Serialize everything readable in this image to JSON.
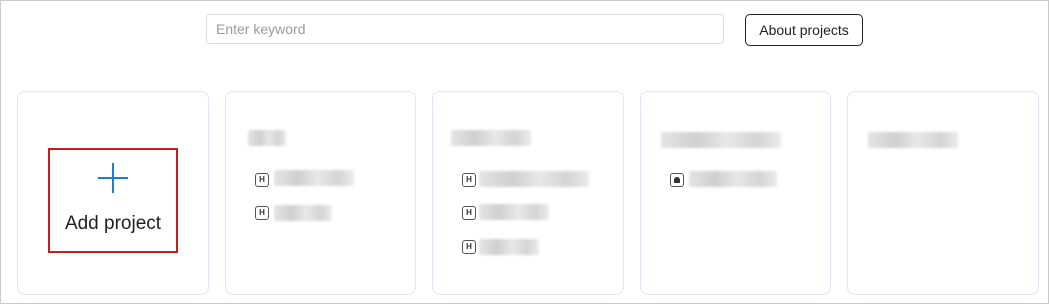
{
  "search": {
    "placeholder": "Enter keyword"
  },
  "header": {
    "about_label": "About projects"
  },
  "add_card": {
    "label": "Add project"
  },
  "project_cards": [
    {
      "title": "",
      "items": [
        {
          "icon": "h-icon",
          "text": ""
        },
        {
          "icon": "h-icon",
          "text": ""
        }
      ]
    },
    {
      "title": "",
      "items": [
        {
          "icon": "h-icon",
          "text": ""
        },
        {
          "icon": "h-icon",
          "text": ""
        },
        {
          "icon": "h-icon",
          "text": ""
        }
      ]
    },
    {
      "title": "",
      "items": [
        {
          "icon": "android-icon",
          "text": ""
        }
      ]
    },
    {
      "title": "",
      "items": []
    }
  ],
  "colors": {
    "accent": "#1a7fd6",
    "highlight_border": "#c91b1b",
    "card_border": "#dbe7f4"
  }
}
